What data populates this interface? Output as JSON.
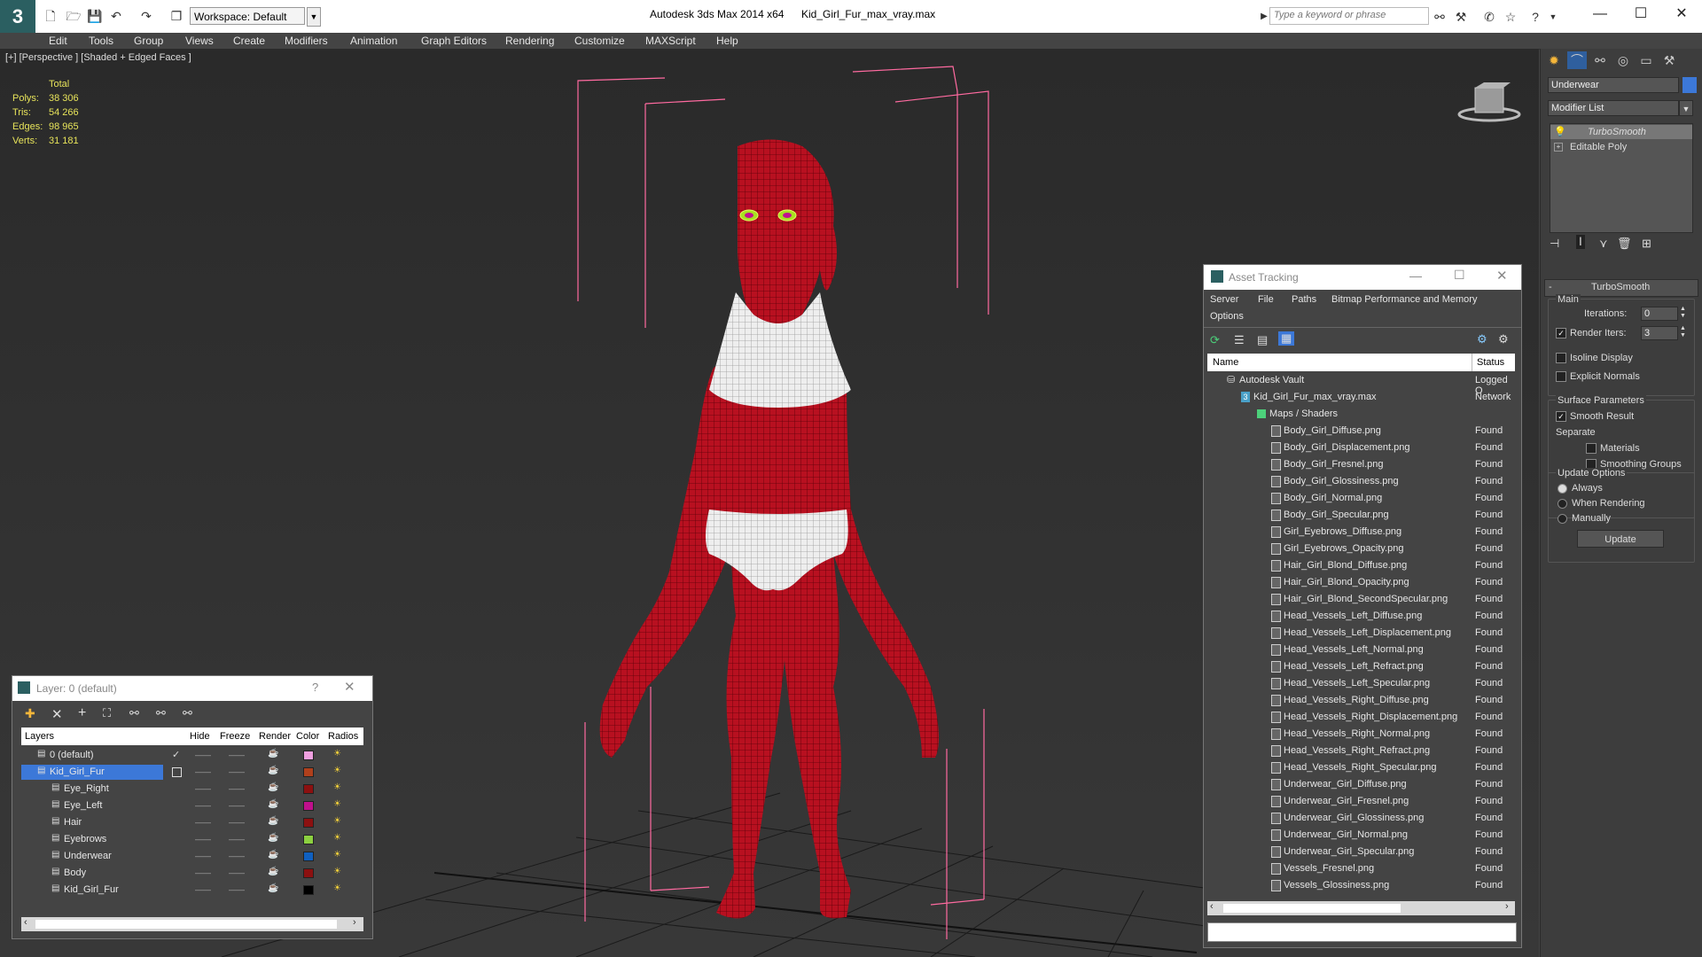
{
  "titlebar": {
    "workspace": "Workspace: Default",
    "app_title": "Autodesk 3ds Max  2014 x64",
    "file_title": "Kid_Girl_Fur_max_vray.max",
    "search_placeholder": "Type a keyword or phrase"
  },
  "menu": [
    "Edit",
    "Tools",
    "Group",
    "Views",
    "Create",
    "Modifiers",
    "Animation",
    "Graph Editors",
    "Rendering",
    "Customize",
    "MAXScript",
    "Help"
  ],
  "viewport": {
    "label": "[+] [Perspective ] [Shaded + Edged Faces ]",
    "stats_header": "Total",
    "stats": [
      {
        "label": "Polys:",
        "value": "38 306"
      },
      {
        "label": "Tris:",
        "value": "54 266"
      },
      {
        "label": "Edges:",
        "value": "98 965"
      },
      {
        "label": "Verts:",
        "value": "31 181"
      }
    ]
  },
  "command_panel": {
    "object_name": "Underwear",
    "modifier_list": "Modifier List",
    "stack": [
      "TurboSmooth",
      "Editable Poly"
    ],
    "rollout_title": "TurboSmooth",
    "main_label": "Main",
    "iterations_label": "Iterations:",
    "iterations_value": "0",
    "render_iters_label": "Render Iters:",
    "render_iters_value": "3",
    "isoline": "Isoline Display",
    "explicit": "Explicit Normals",
    "surface_params": "Surface Parameters",
    "smooth_result": "Smooth Result",
    "separate": "Separate",
    "materials": "Materials",
    "smoothing_groups": "Smoothing Groups",
    "update_options": "Update Options",
    "always": "Always",
    "when_rendering": "When Rendering",
    "manually": "Manually",
    "update_button": "Update"
  },
  "asset_tracking": {
    "title": "Asset Tracking",
    "menu1": [
      "Server",
      "File",
      "Paths",
      "Bitmap Performance and Memory"
    ],
    "menu2": "Options",
    "col_name": "Name",
    "col_status": "Status",
    "vault": {
      "name": "Autodesk Vault",
      "status": "Logged O"
    },
    "file": {
      "name": "Kid_Girl_Fur_max_vray.max",
      "status": "Network"
    },
    "folder": "Maps / Shaders",
    "maps": [
      "Body_Girl_Diffuse.png",
      "Body_Girl_Displacement.png",
      "Body_Girl_Fresnel.png",
      "Body_Girl_Glossiness.png",
      "Body_Girl_Normal.png",
      "Body_Girl_Specular.png",
      "Girl_Eyebrows_Diffuse.png",
      "Girl_Eyebrows_Opacity.png",
      "Hair_Girl_Blond_Diffuse.png",
      "Hair_Girl_Blond_Opacity.png",
      "Hair_Girl_Blond_SecondSpecular.png",
      "Head_Vessels_Left_Diffuse.png",
      "Head_Vessels_Left_Displacement.png",
      "Head_Vessels_Left_Normal.png",
      "Head_Vessels_Left_Refract.png",
      "Head_Vessels_Left_Specular.png",
      "Head_Vessels_Right_Diffuse.png",
      "Head_Vessels_Right_Displacement.png",
      "Head_Vessels_Right_Normal.png",
      "Head_Vessels_Right_Refract.png",
      "Head_Vessels_Right_Specular.png",
      "Underwear_Girl_Diffuse.png",
      "Underwear_Girl_Fresnel.png",
      "Underwear_Girl_Glossiness.png",
      "Underwear_Girl_Normal.png",
      "Underwear_Girl_Specular.png",
      "Vessels_Fresnel.png",
      "Vessels_Glossiness.png"
    ],
    "found": "Found"
  },
  "layers": {
    "title": "Layer: 0 (default)",
    "headers": [
      "Layers",
      "Hide",
      "Freeze",
      "Render",
      "Color",
      "Radios"
    ],
    "rows": [
      {
        "name": "0 (default)",
        "color": "#f0a0e0"
      },
      {
        "name": "Kid_Girl_Fur",
        "color": "#b0401c"
      },
      {
        "name": "Eye_Right",
        "color": "#8c1010"
      },
      {
        "name": "Eye_Left",
        "color": "#c0108c"
      },
      {
        "name": "Hair",
        "color": "#8c1010"
      },
      {
        "name": "Eyebrows",
        "color": "#8cd040"
      },
      {
        "name": "Underwear",
        "color": "#1060c0"
      },
      {
        "name": "Body",
        "color": "#8c1010"
      },
      {
        "name": "Kid_Girl_Fur",
        "color": "#000000"
      }
    ]
  },
  "colors": {
    "mesh": "#b81020",
    "accent": "#3c78d8",
    "selection_box": "#ff6aa0"
  }
}
